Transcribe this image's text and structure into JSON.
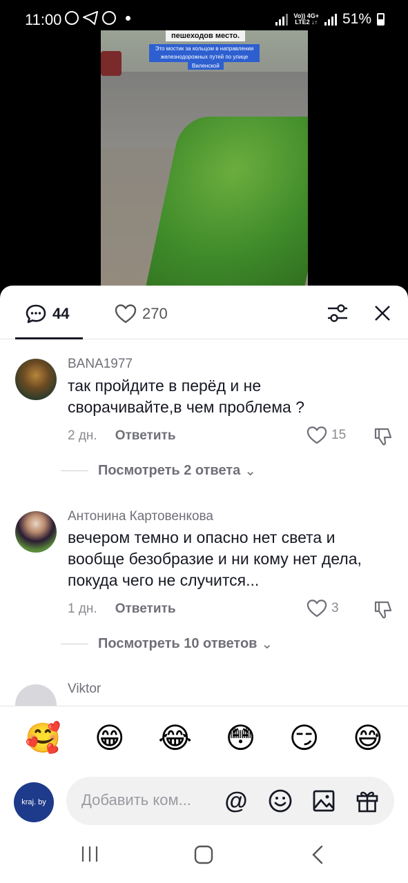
{
  "status_bar": {
    "time": "11:00",
    "battery": "51%",
    "network_top": "Vo)) 4G+",
    "network_bottom": "LTE2 ↓↑"
  },
  "video": {
    "caption_line1": "пешеходов место.",
    "caption_line2": "Это мостик за кольцом в направлении железнодорожных путей по улице",
    "caption_line3": "Виленской"
  },
  "tabs": {
    "comments_count": "44",
    "likes_count": "270"
  },
  "comments": [
    {
      "username": "BANA1977",
      "text": "так пройдите в перёд и не сворачивайте,в чем проблема ?",
      "time": "2 дн.",
      "reply_label": "Ответить",
      "likes": "15",
      "replies_label": "Посмотреть 2 ответа"
    },
    {
      "username": "Антонина Картовенкова",
      "text": "вечером темно и опасно нет света и вообще безобразие и ни кому нет дела, покуда чего не случится...",
      "time": "1 дн.",
      "reply_label": "Ответить",
      "likes": "3",
      "replies_label": "Посмотреть 10 ответов"
    },
    {
      "username": "Viktor"
    }
  ],
  "emojis": [
    "🥰",
    "😁",
    "😂",
    "😳",
    "😏",
    "😅"
  ],
  "composer": {
    "placeholder": "Добавить ком...",
    "avatar_text": "kraj. by"
  },
  "colors": {
    "text_primary": "#161823",
    "text_secondary": "#6f6f78",
    "background": "#ffffff"
  }
}
